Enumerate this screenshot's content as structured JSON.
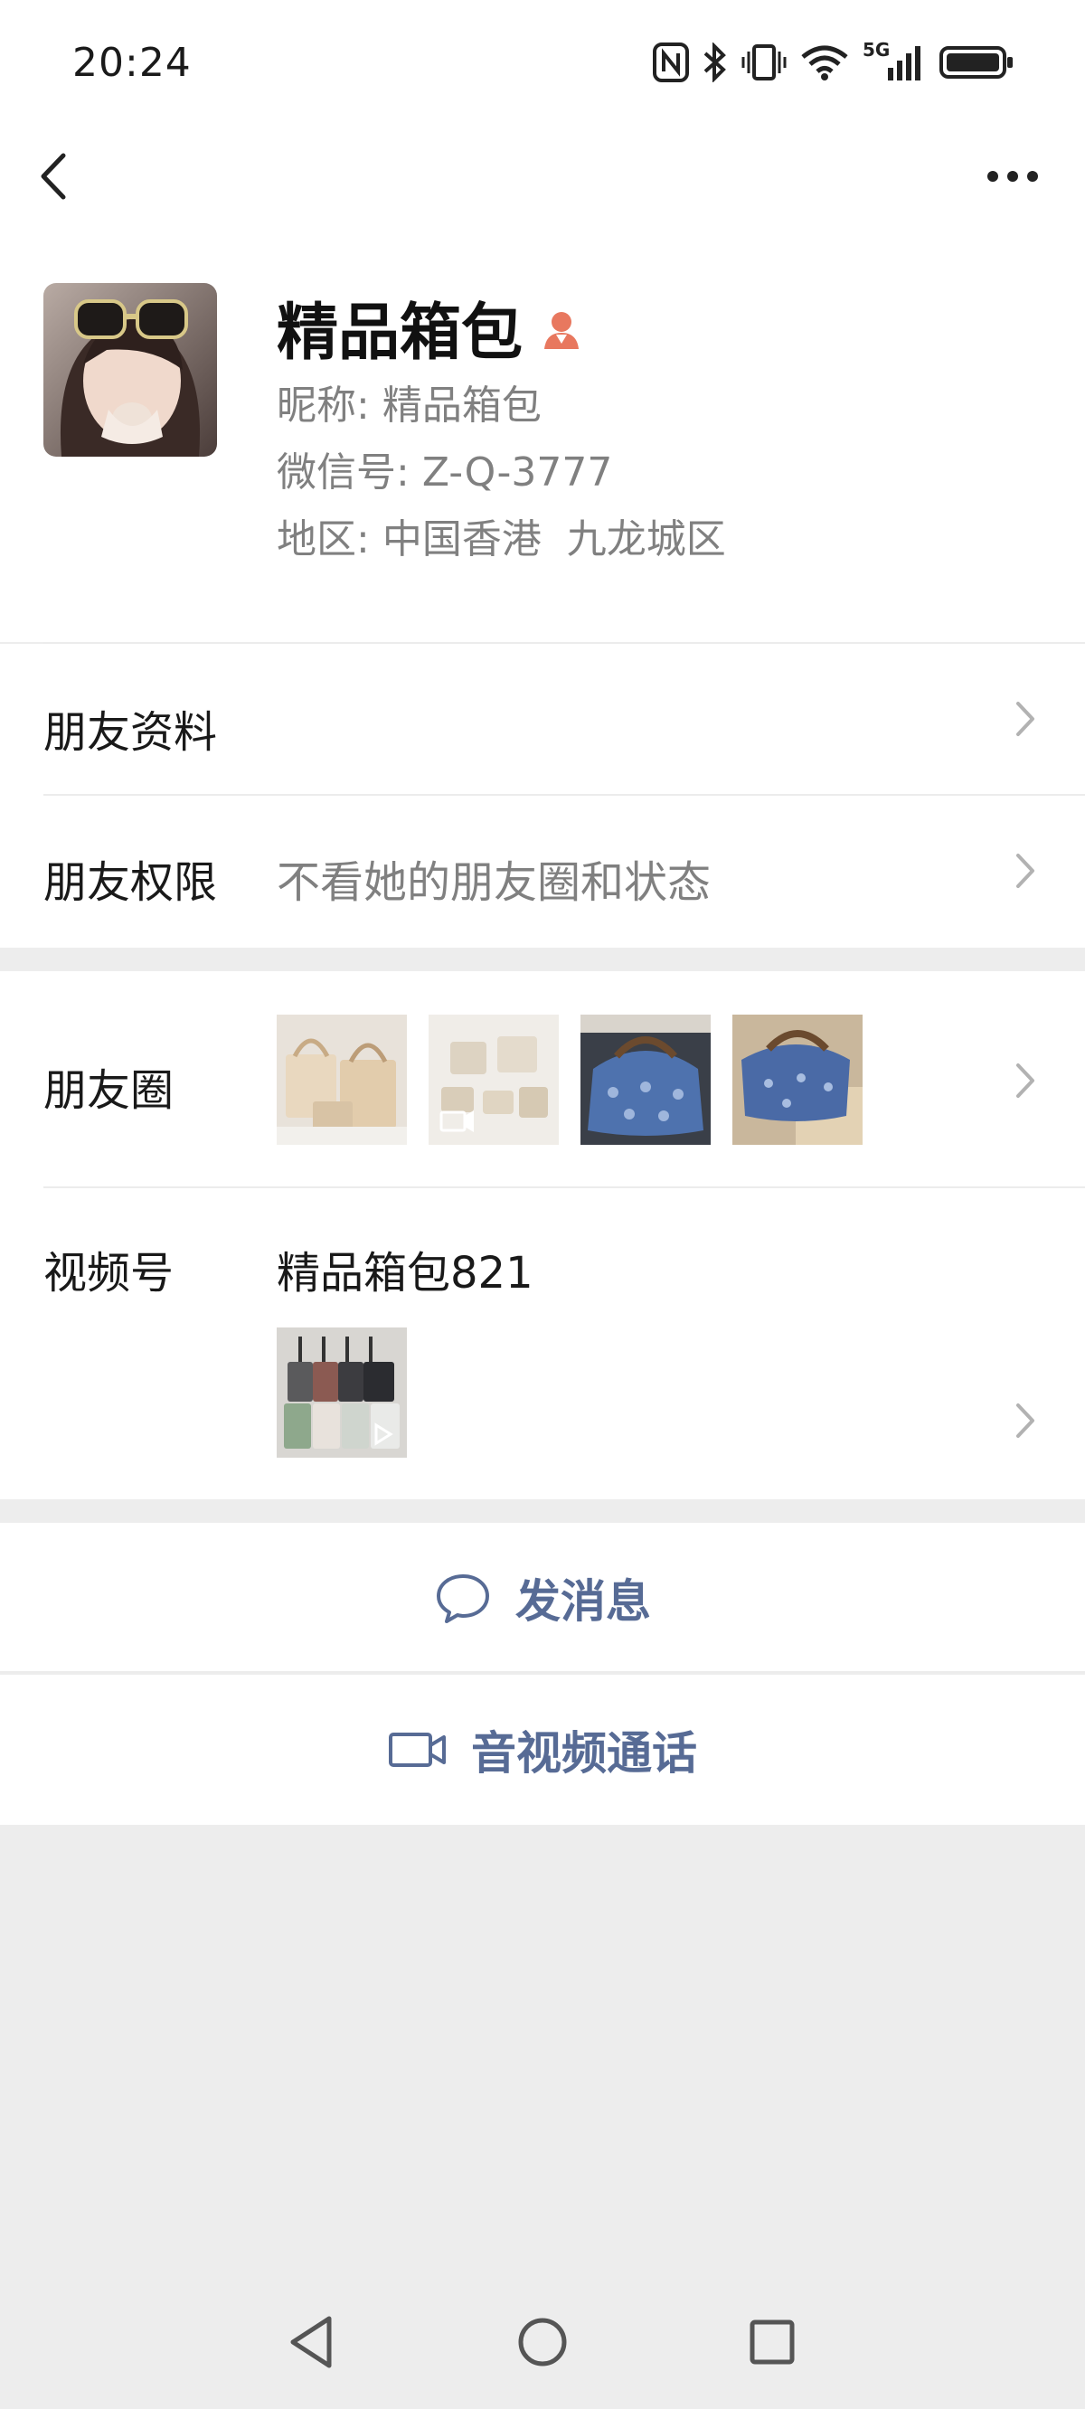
{
  "status_bar": {
    "time": "20:24",
    "network_label": "5G",
    "icons": [
      "nfc-icon",
      "bluetooth-icon",
      "vibrate-icon",
      "wifi-icon",
      "signal-icon",
      "battery-icon"
    ]
  },
  "nav": {
    "back_icon": "chevron-left-icon",
    "more_icon": "more-dots-icon"
  },
  "profile": {
    "name": "精品箱包",
    "gender_icon": "female-icon",
    "nickname_label": "昵称:",
    "nickname": "精品箱包",
    "wechat_id_label": "微信号:",
    "wechat_id": "Z-Q-3777",
    "region_label": "地区:",
    "region": "中国香港  九龙城区"
  },
  "rows": {
    "friend_info_label": "朋友资料",
    "friend_perm_label": "朋友权限",
    "friend_perm_value": "不看她的朋友圈和状态",
    "moments_label": "朋友圈",
    "channels_label": "视频号",
    "channels_name": "精品箱包821"
  },
  "actions": {
    "message_label": "发消息",
    "call_label": "音视频通话"
  },
  "colors": {
    "link_blue": "#576b95",
    "background": "#ededed",
    "gender_female": "#e8785f"
  }
}
